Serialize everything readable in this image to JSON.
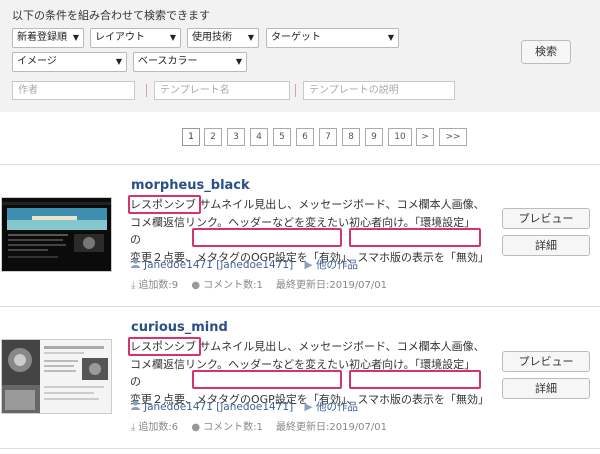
{
  "search": {
    "caption": "以下の条件を組み合わせて検索できます",
    "selects": [
      "新着登録順",
      "レイアウト",
      "使用技術",
      "ターゲット",
      "イメージ",
      "ベースカラー"
    ],
    "placeholders": {
      "author": "作者",
      "template_name": "テンプレート名",
      "description": "テンプレートの説明"
    },
    "button": "検索"
  },
  "pagination": [
    "1",
    "2",
    "3",
    "4",
    "5",
    "6",
    "7",
    "8",
    "9",
    "10",
    ">",
    ">>"
  ],
  "items": [
    {
      "title": "morpheus_black",
      "desc_lines": [
        "レスポンシブ  サムネイル見出し、メッセージボード、コメ欄本人画像、",
        "コメ欄返信リンク。ヘッダーなどを変えたい初心者向け。「環境設定」の",
        "変更２点要、メタタグのOGP設定を「有効」、スマホ版の表示を「無効」"
      ],
      "author": "Janedoe1471 [janedoe1471]",
      "other_works": "他の作品",
      "added": "追加数:9",
      "comments": "コメント数:1",
      "updated": "最終更新日:2019/07/01",
      "preview_label": "プレビュー",
      "detail_label": "詳細"
    },
    {
      "title": "curious_mind",
      "desc_lines": [
        "レスポンシブ  サムネイル見出し、メッセージボード、コメ欄本人画像、",
        "コメ欄返信リンク。ヘッダーなどを変えたい初心者向け。「環境設定」の",
        "変更２点要、メタタグのOGP設定を「有効」、スマホ版の表示を「無効」"
      ],
      "author": "Janedoe1471 [janedoe1471]",
      "other_works": "他の作品",
      "added": "追加数:6",
      "comments": "コメント数:1",
      "updated": "最終更新日:2019/07/01",
      "preview_label": "プレビュー",
      "detail_label": "詳細"
    }
  ],
  "colors": {
    "highlight": "#d6336c",
    "title": "#2a4f86",
    "panel_bg": "#f2f2f2"
  }
}
